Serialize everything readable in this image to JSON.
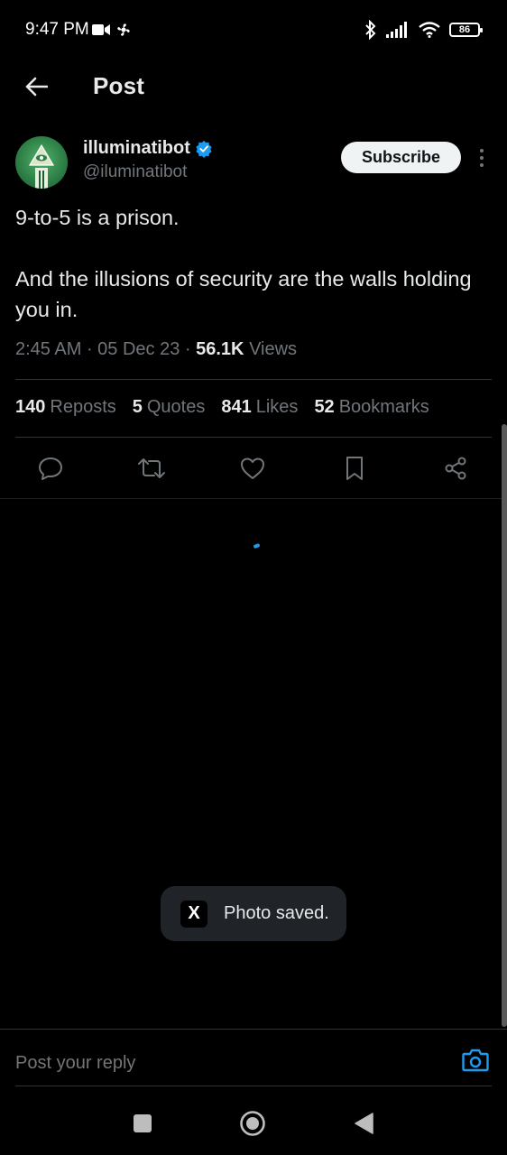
{
  "status_bar": {
    "time": "9:47 PM",
    "battery": "86"
  },
  "header": {
    "title": "Post"
  },
  "author": {
    "name": "illuminatibot",
    "handle": "@iluminatibot",
    "subscribe_label": "Subscribe"
  },
  "tweet": {
    "line1": "9-to-5 is a prison.",
    "line2": "And the illusions of security are the walls holding you in.",
    "time": "2:45 AM",
    "date": "05 Dec 23",
    "views_count": "56.1K",
    "views_label": "Views"
  },
  "stats": {
    "reposts_count": "140",
    "reposts_label": "Reposts",
    "quotes_count": "5",
    "quotes_label": "Quotes",
    "likes_count": "841",
    "likes_label": "Likes",
    "bookmarks_count": "52",
    "bookmarks_label": "Bookmarks"
  },
  "toast": {
    "icon_letter": "X",
    "text": "Photo saved."
  },
  "reply": {
    "placeholder": "Post your reply"
  },
  "colors": {
    "accent": "#1d9bf0",
    "background": "#000000",
    "secondary_text": "#71767b"
  },
  "icons": [
    "back-arrow-icon",
    "verified-badge-icon",
    "more-icon",
    "reply-icon",
    "repost-icon",
    "like-icon",
    "bookmark-icon",
    "share-icon",
    "camera-icon",
    "x-logo-icon"
  ]
}
